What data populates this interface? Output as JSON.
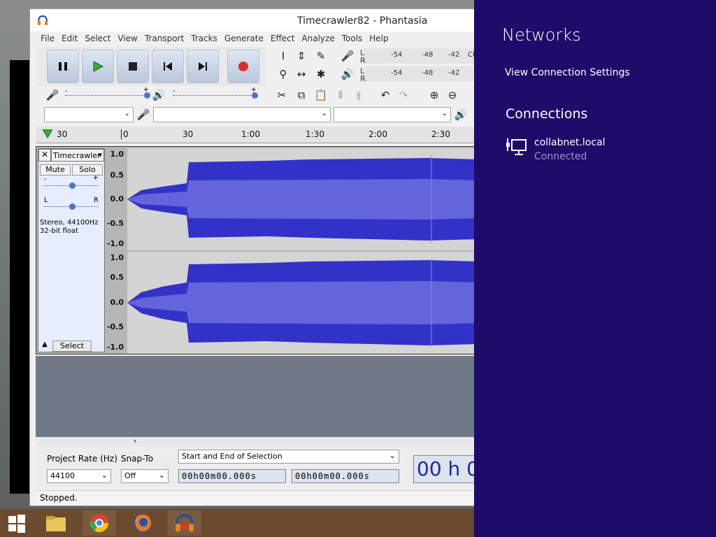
{
  "window": {
    "title": "Timecrawler82 - Phantasia"
  },
  "menu": [
    "File",
    "Edit",
    "Select",
    "View",
    "Transport",
    "Tracks",
    "Generate",
    "Effect",
    "Analyze",
    "Tools",
    "Help"
  ],
  "meters": {
    "labels": [
      "-54",
      "-48",
      "-42"
    ],
    "clip": "Cli",
    "L": "L",
    "R": "R"
  },
  "ruler": {
    "ticks": [
      "30",
      "0",
      "30",
      "1:00",
      "1:30",
      "2:00",
      "2:30"
    ]
  },
  "track": {
    "name": "Timecrawler",
    "mute": "Mute",
    "solo": "Solo",
    "gain_minus": "-",
    "gain_plus": "+",
    "pan_left": "L",
    "pan_right": "R",
    "info_line1": "Stereo, 44100Hz",
    "info_line2": "32-bit float",
    "select": "Select",
    "scale": [
      "1.0",
      "0.5",
      "0.0",
      "-0.5",
      "-1.0"
    ]
  },
  "selection_toolbar": {
    "project_rate_label": "Project Rate (Hz)",
    "project_rate_value": "44100",
    "snap_to_label": "Snap-To",
    "snap_to_value": "Off",
    "selection_mode": "Start and End of Selection",
    "start_time": "00h00m00.000s",
    "end_time": "00h00m00.000s",
    "big_time": "00 h 0"
  },
  "status": "Stopped.",
  "network_panel": {
    "title": "Networks",
    "view_settings": "View Connection Settings",
    "connections_heading": "Connections",
    "connection_name": "collabnet.local",
    "connection_status": "Connected"
  },
  "colors": {
    "waveform": "#3232c8",
    "waveform_rms": "#6464dc",
    "panel_bg": "#1f0b6a",
    "record": "#d92c2c",
    "play": "#3aa83a"
  }
}
